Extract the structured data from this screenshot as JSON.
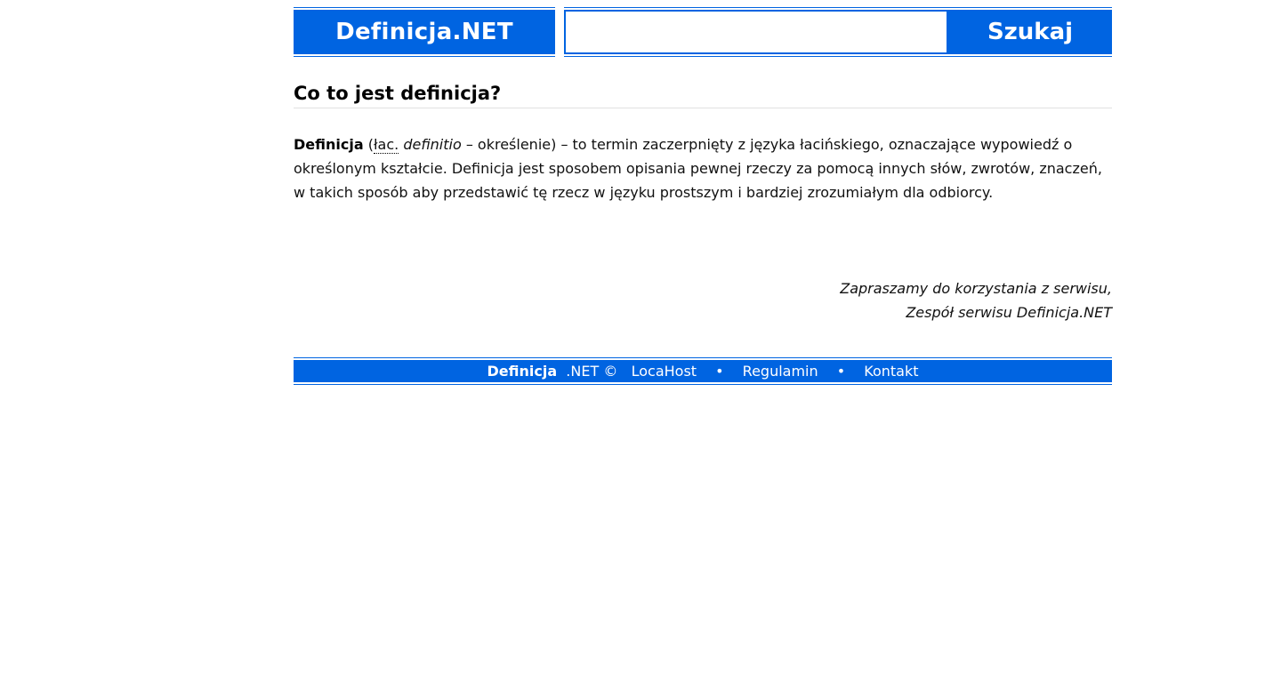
{
  "header": {
    "logo_label": "Definicja.NET",
    "search_placeholder": "",
    "search_value": "",
    "search_button_label": "Szukaj"
  },
  "main": {
    "title": "Co to jest definicja?",
    "term": "Definicja",
    "open_paren": "(",
    "abbr": "łac.",
    "latin": "definitio",
    "rest": "– określenie) – to termin zaczerpnięty z języka łacińskiego, oznaczające wypowiedź o określonym kształcie. Definicja jest sposobem opisania pewnej rzeczy za pomocą innych słów, zwrotów, znaczeń, w takich sposób aby przedstawić tę rzecz w języku prostszym i bardziej zrozumiałym dla odbiorcy."
  },
  "signature": {
    "line1": "Zapraszamy do korzystania z serwisu,",
    "line2": "Zespół serwisu Definicja.NET"
  },
  "footer": {
    "brand": "Definicja",
    "suffix": ".NET ©",
    "links": [
      "LocaHost",
      "Regulamin",
      "Kontakt"
    ],
    "separator": "•"
  },
  "colors": {
    "accent": "#0064e1"
  }
}
